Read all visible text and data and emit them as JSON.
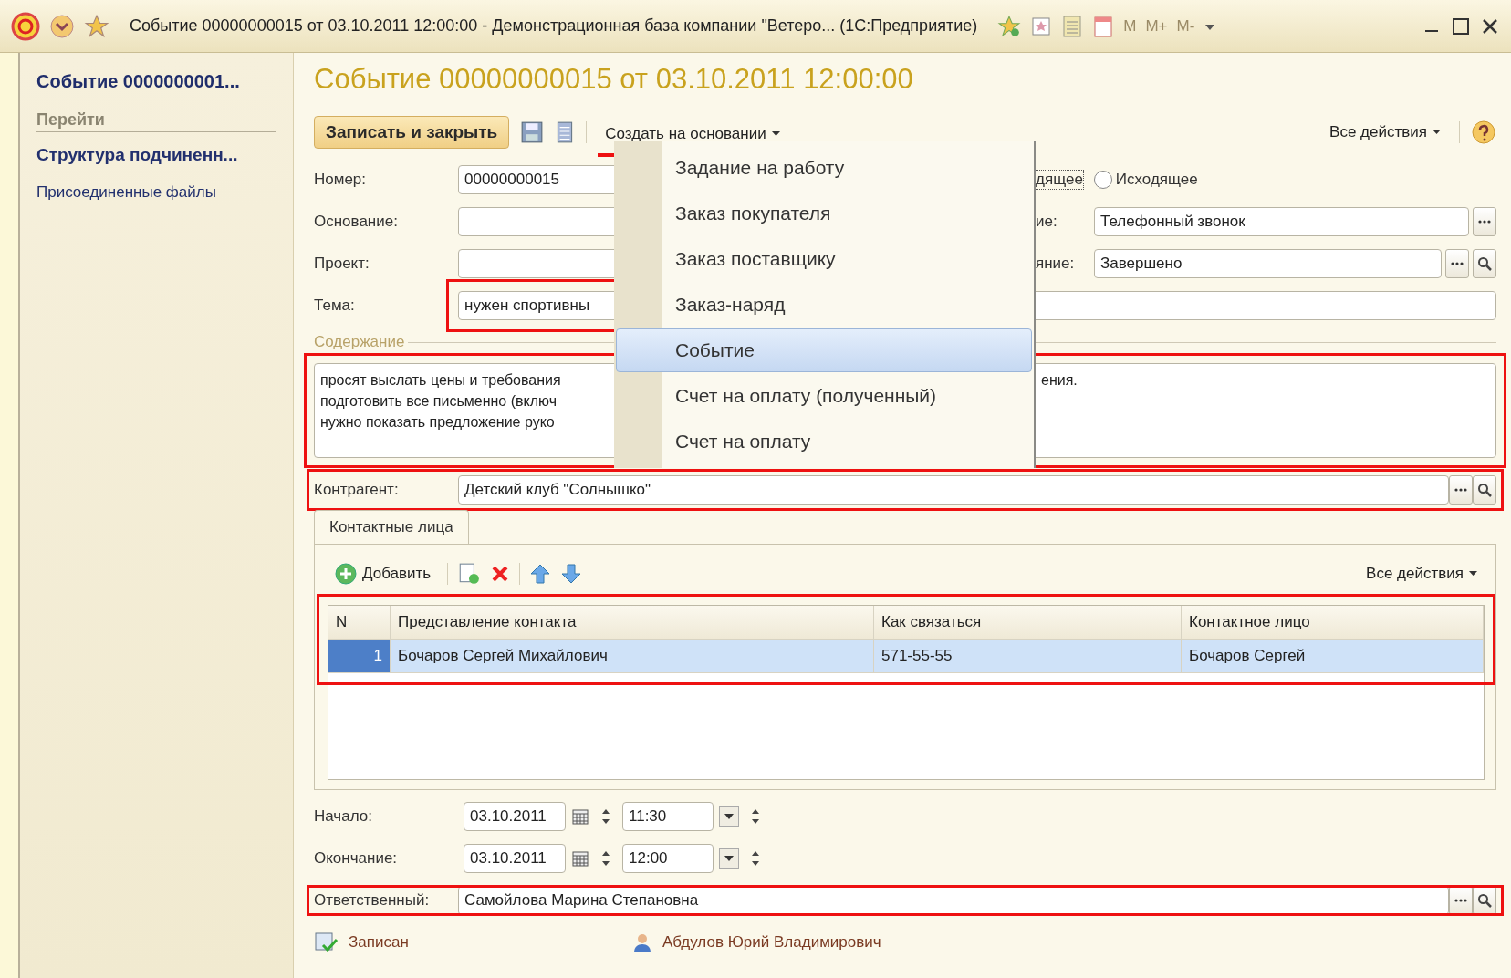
{
  "window": {
    "title": "Событие 00000000015 от 03.10.2011 12:00:00 - Демонстрационная база компании \"Ветеро...  (1С:Предприятие)",
    "memory_keys": [
      "M",
      "M+",
      "M-"
    ]
  },
  "sidebar": {
    "title": "Событие 0000000001...",
    "section": "Перейти",
    "items": [
      {
        "label": "Структура подчиненн...",
        "selected": true
      },
      {
        "label": "Присоединенные файлы",
        "selected": false
      }
    ]
  },
  "form": {
    "title": "Событие 00000000015 от 03.10.2011 12:00:00"
  },
  "toolbar": {
    "primary": "Записать и закрыть",
    "create_based": {
      "label": "Создать на основании",
      "highlighted": true
    },
    "all_actions": "Все действия"
  },
  "menu": {
    "items": [
      {
        "label": "Задание на работу",
        "selected": false
      },
      {
        "label": "Заказ покупателя",
        "selected": false
      },
      {
        "label": "Заказ поставщику",
        "selected": false
      },
      {
        "label": "Заказ-наряд",
        "selected": false
      },
      {
        "label": "Событие",
        "selected": true
      },
      {
        "label": "Счет на оплату (полученный)",
        "selected": false
      },
      {
        "label": "Счет на оплату",
        "selected": false
      }
    ]
  },
  "number": {
    "label": "Номер:",
    "value": "00000000015"
  },
  "basis": {
    "label": "Основание:"
  },
  "project": {
    "label": "Проект:"
  },
  "topic": {
    "label": "Тема:",
    "value": "нужен спортивны",
    "highlighted": true
  },
  "direction": {
    "incoming_fragment": "дящее",
    "outgoing": {
      "label": "Исходящее",
      "selected": false
    }
  },
  "event_type": {
    "label": "ие:",
    "value": "Телефонный звонок"
  },
  "state": {
    "label": "яние:",
    "value": "Завершено"
  },
  "content": {
    "label": "Содержание",
    "lines_left": [
      "просят выслать цены и требования",
      "подготовить все письменно (включ",
      "нужно показать предложение руко"
    ],
    "lines_right": [
      "ения."
    ],
    "highlighted": true
  },
  "counterparty": {
    "label": "Контрагент:",
    "value": "Детский клуб \"Солнышко\"",
    "highlighted": true
  },
  "contacts": {
    "tab": "Контактные лица",
    "add": "Добавить",
    "all_actions": "Все действия",
    "columns": [
      "N",
      "Представление контакта",
      "Как связаться",
      "Контактное лицо"
    ],
    "highlighted": true,
    "rows": [
      {
        "cells": [
          "1",
          "Бочаров Сергей Михайлович",
          "571-55-55",
          "Бочаров Сергей"
        ],
        "selected": true
      }
    ]
  },
  "start": {
    "label": "Начало:",
    "date": "03.10.2011",
    "time": "11:30"
  },
  "end": {
    "label": "Окончание:",
    "date": "03.10.2011",
    "time": "12:00"
  },
  "responsible": {
    "label": "Ответственный:",
    "value": "Самойлова Марина Степановна",
    "highlighted": true
  },
  "footer": {
    "status": "Записан",
    "author": "Абдулов Юрий Владимирович"
  }
}
